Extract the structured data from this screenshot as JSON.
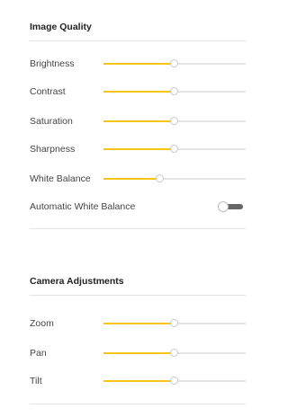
{
  "colors": {
    "accent": "#f5c518",
    "track": "#e4e4e4",
    "toggle_off": "#666666"
  },
  "image_quality": {
    "title": "Image Quality",
    "sliders": [
      {
        "label": "Brightness",
        "value_percent": 50
      },
      {
        "label": "Contrast",
        "value_percent": 50
      },
      {
        "label": "Saturation",
        "value_percent": 50
      },
      {
        "label": "Sharpness",
        "value_percent": 50
      },
      {
        "label": "White Balance",
        "value_percent": 40
      }
    ],
    "auto_white_balance": {
      "label": "Automatic White Balance",
      "enabled": false
    }
  },
  "camera_adjustments": {
    "title": "Camera Adjustments",
    "sliders": [
      {
        "label": "Zoom",
        "value_percent": 50
      },
      {
        "label": "Pan",
        "value_percent": 50
      },
      {
        "label": "Tilt",
        "value_percent": 50
      }
    ]
  }
}
